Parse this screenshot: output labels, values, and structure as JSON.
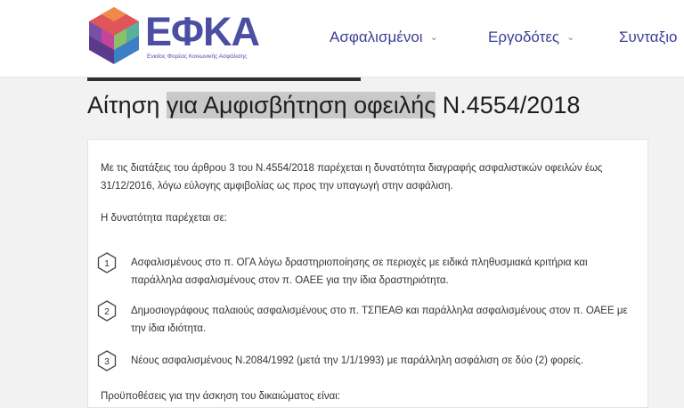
{
  "header": {
    "logo_text": "ΕΦΚΑ",
    "logo_subtitle": "Ενιαίος Φορέας Κοινωνικής Ασφάλισης",
    "nav": [
      {
        "label": "Ασφαλισμένοι"
      },
      {
        "label": "Εργοδότες"
      },
      {
        "label": "Συνταξιο"
      }
    ]
  },
  "page": {
    "title_part1": "Αίτηση ",
    "title_part2": "για Αμφισβήτηση οφειλής",
    "title_part3": " Ν.4554/2018"
  },
  "content": {
    "intro": "Με τις διατάξεις του άρθρου 3 του Ν.4554/2018  παρέχεται η δυνατότητα διαγραφής ασφαλιστικών οφειλών έως 31/12/2016, λόγω εύλογης αμφιβολίας ως προς την υπαγωγή στην ασφάλιση.",
    "subhead": "Η δυνατότητα παρέχεται σε:",
    "items": [
      {
        "number": "1",
        "text": "Ασφαλισμένους στο π. ΟΓΑ λόγω  δραστηριοποίησης σε περιοχές με ειδικά πληθυσμιακά κριτήρια και παράλληλα ασφαλισμένους  στον π. ΟΑΕΕ για την ίδια δραστηριότητα."
      },
      {
        "number": "2",
        "text": "Δημοσιογράφους παλαιούς ασφαλισμένους στο π. ΤΣΠΕΑΘ και παράλληλα ασφαλισμένους στον π. ΟΑΕΕ με την ίδια ιδιότητα."
      },
      {
        "number": "3",
        "text": "Νέους ασφαλισμένους Ν.2084/1992 (μετά την 1/1/1993) με παράλληλη ασφάλιση σε δύο (2) φορείς."
      }
    ],
    "footer_partial": "Προϋποθέσεις για την άσκηση του δικαιώματος είναι:"
  },
  "colors": {
    "brand": "#4b4fa3",
    "nav_text": "#3b3f96",
    "title_highlight": "#c9c9c9"
  }
}
